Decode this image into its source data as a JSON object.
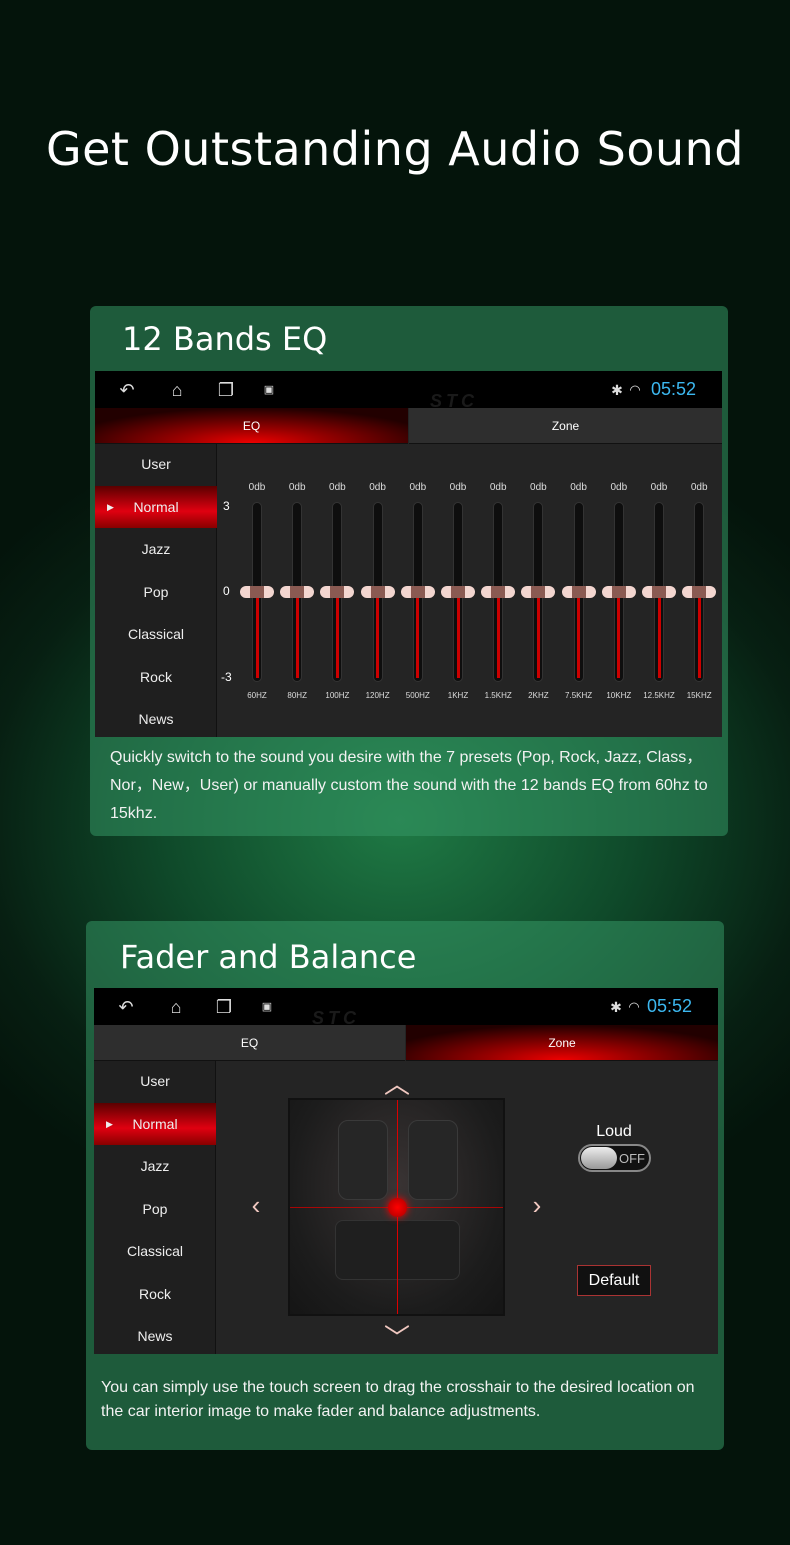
{
  "headline": "Get Outstanding Audio Sound",
  "eq_panel": {
    "title": "12 Bands EQ",
    "status": {
      "time": "05:52",
      "watermark": "STC",
      "icons": [
        "back-icon",
        "home-icon",
        "recent-apps-icon",
        "gallery-icon",
        "bluetooth-icon",
        "wifi-icon"
      ]
    },
    "tabs": [
      {
        "label": "EQ",
        "active": true
      },
      {
        "label": "Zone",
        "active": false
      }
    ],
    "presets": [
      "User",
      "Normal",
      "Jazz",
      "Pop",
      "Classical",
      "Rock",
      "News"
    ],
    "selected_preset": "Normal",
    "axis": {
      "top": "3",
      "mid": "0",
      "bottom": "-3"
    },
    "bands": [
      {
        "freq": "60HZ",
        "gain_label": "0db",
        "gain": 0
      },
      {
        "freq": "80HZ",
        "gain_label": "0db",
        "gain": 0
      },
      {
        "freq": "100HZ",
        "gain_label": "0db",
        "gain": 0
      },
      {
        "freq": "120HZ",
        "gain_label": "0db",
        "gain": 0
      },
      {
        "freq": "500HZ",
        "gain_label": "0db",
        "gain": 0
      },
      {
        "freq": "1KHZ",
        "gain_label": "0db",
        "gain": 0
      },
      {
        "freq": "1.5KHZ",
        "gain_label": "0db",
        "gain": 0
      },
      {
        "freq": "2KHZ",
        "gain_label": "0db",
        "gain": 0
      },
      {
        "freq": "7.5KHZ",
        "gain_label": "0db",
        "gain": 0
      },
      {
        "freq": "10KHZ",
        "gain_label": "0db",
        "gain": 0
      },
      {
        "freq": "12.5KHZ",
        "gain_label": "0db",
        "gain": 0
      },
      {
        "freq": "15KHZ",
        "gain_label": "0db",
        "gain": 0
      }
    ],
    "description": "Quickly switch to the sound you desire with the 7 presets (Pop, Rock, Jazz, Class，Nor，New，User) or manually custom the sound with the 12 bands EQ from 60hz to 15khz."
  },
  "zone_panel": {
    "title": "Fader and Balance",
    "status": {
      "time": "05:52",
      "watermark": "STC"
    },
    "tabs": [
      {
        "label": "EQ",
        "active": false
      },
      {
        "label": "Zone",
        "active": true
      }
    ],
    "presets": [
      "User",
      "Normal",
      "Jazz",
      "Pop",
      "Classical",
      "Rock",
      "News"
    ],
    "selected_preset": "Normal",
    "loud_label": "Loud",
    "loud_state": "OFF",
    "default_label": "Default",
    "crosshair": {
      "fader": 0,
      "balance": 0
    },
    "description": "You can simply use the touch screen to drag the crosshair to the desired location on the car interior image to make fader and balance adjustments."
  },
  "colors": {
    "accent_red": "#e00010",
    "clock_blue": "#3cb8f0"
  }
}
